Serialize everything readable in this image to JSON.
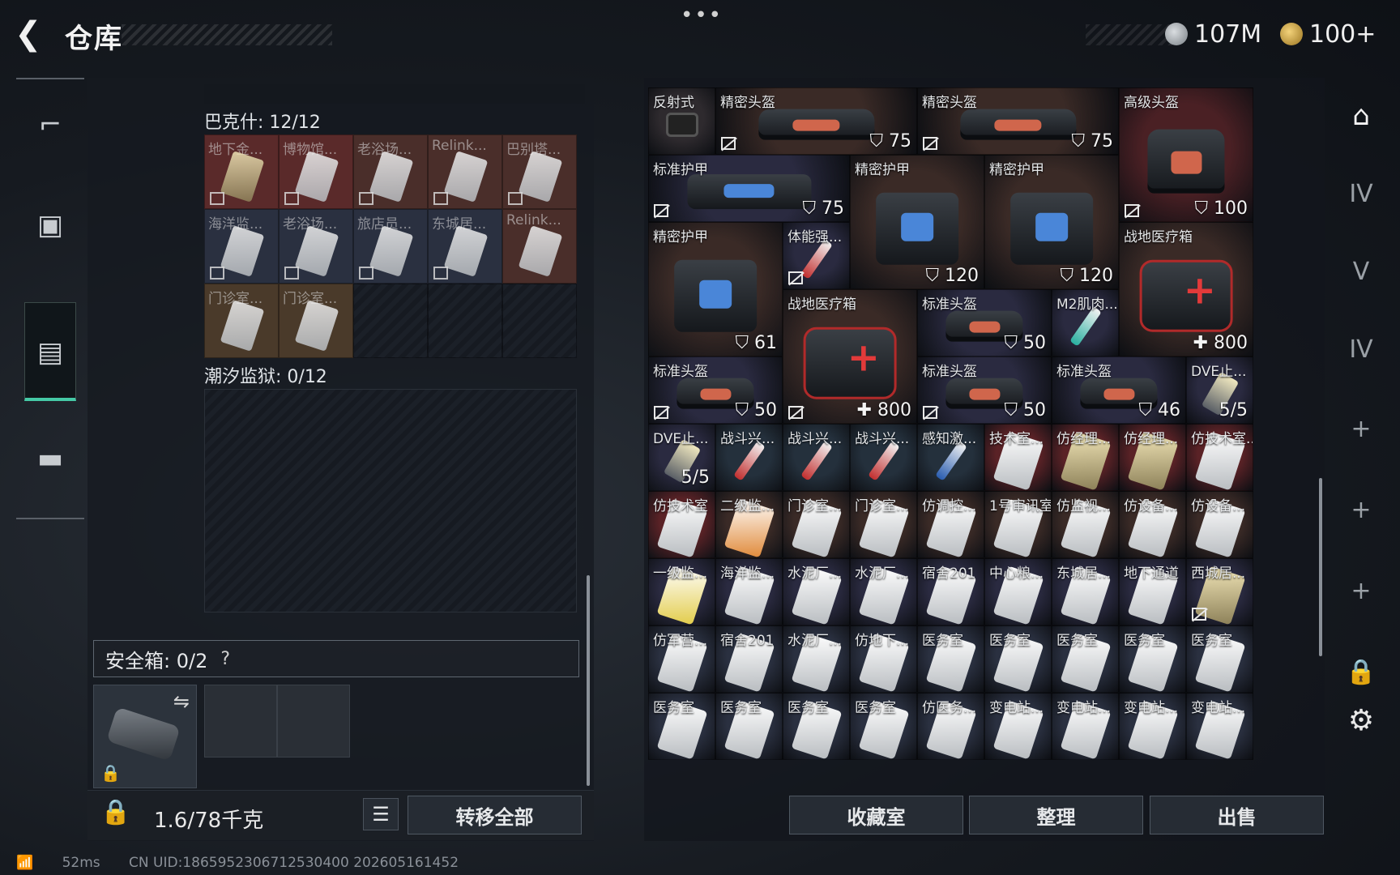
{
  "header": {
    "title": "仓库",
    "back_icon": "chevron-left-icon",
    "more": "•••",
    "currency": [
      {
        "icon": "silver-coin-icon",
        "value": "107M"
      },
      {
        "icon": "gold-coin-icon",
        "value": "100+"
      }
    ]
  },
  "left_rail": {
    "items": [
      "gun-icon",
      "backpack-icon",
      "vest-icon",
      "toolbox-icon"
    ],
    "active_index": 2,
    "active_color": "#45c9a6"
  },
  "containers": {
    "bakesh": {
      "label": "巴克什: 12/12",
      "items": [
        {
          "name": "地下金...",
          "bg": "#5a2a2a",
          "card": "gold",
          "nobind": true
        },
        {
          "name": "博物馆...",
          "bg": "#5a2a2a",
          "card": "white",
          "nobind": true
        },
        {
          "name": "老浴场...",
          "bg": "#4a2e2a",
          "card": "white",
          "nobind": true
        },
        {
          "name": "Relink...",
          "bg": "#4a2e2a",
          "card": "white",
          "nobind": true
        },
        {
          "name": "巴别塔...",
          "bg": "#4a2e2a",
          "card": "white",
          "nobind": true
        },
        {
          "name": "海洋监...",
          "bg": "#2a3040",
          "card": "white",
          "nobind": true
        },
        {
          "name": "老浴场...",
          "bg": "#2a3040",
          "card": "white",
          "nobind": true
        },
        {
          "name": "旅店员...",
          "bg": "#2a3040",
          "card": "white",
          "nobind": true
        },
        {
          "name": "东城居...",
          "bg": "#2a3040",
          "card": "white",
          "nobind": true
        },
        {
          "name": "Relink...",
          "bg": "#4a2e2a",
          "card": "white",
          "nobind": false
        },
        {
          "name": "门诊室...",
          "bg": "#4a3a2a",
          "card": "white",
          "nobind": false
        },
        {
          "name": "门诊室...",
          "bg": "#4a3a2a",
          "card": "white",
          "nobind": false
        }
      ]
    },
    "chaoxi": {
      "label": "潮汐监狱: 0/12"
    },
    "safe": {
      "label": "安全箱: 0/2",
      "help": "?",
      "swap_icon": "swap-icon",
      "lock_icon": "lock-icon"
    }
  },
  "weight": {
    "text": "1.6/78千克",
    "lock_icon": "lock-icon"
  },
  "buttons": {
    "list_icon": "list-icon",
    "transfer_all": "转移全部",
    "collection": "收藏室",
    "sort": "整理",
    "sell": "出售"
  },
  "warehouse": {
    "items": [
      {
        "name": "反射式",
        "c": 0,
        "r": 0,
        "w": 1,
        "h": 1,
        "bg": "#2e2a2e",
        "sprite": "scope"
      },
      {
        "name": "精密头盔",
        "c": 1,
        "r": 0,
        "w": 3,
        "h": 1,
        "bg": "#3a2a26",
        "sprite": "helmet",
        "value": "⛉ 75",
        "nobind": true
      },
      {
        "name": "精密头盔",
        "c": 4,
        "r": 0,
        "w": 3,
        "h": 1,
        "bg": "#3a2a26",
        "sprite": "helmet",
        "value": "⛉ 75",
        "nobind": true
      },
      {
        "name": "高级头盔",
        "c": 7,
        "r": 0,
        "w": 2,
        "h": 2,
        "bg": "#4a2024",
        "sprite": "helmet",
        "value": "⛉ 100",
        "nobind": true
      },
      {
        "name": "标准护甲",
        "c": 0,
        "r": 1,
        "w": 3,
        "h": 1,
        "bg": "#2a2a40",
        "sprite": "armor",
        "value": "⛉ 75",
        "nobind": true
      },
      {
        "name": "精密护甲",
        "c": 3,
        "r": 1,
        "w": 2,
        "h": 2,
        "bg": "#3a2a26",
        "sprite": "armor",
        "value": "⛉ 120"
      },
      {
        "name": "精密护甲",
        "c": 5,
        "r": 1,
        "w": 2,
        "h": 2,
        "bg": "#3a2a26",
        "sprite": "armor",
        "value": "⛉ 120"
      },
      {
        "name": "精密护甲",
        "c": 0,
        "r": 2,
        "w": 2,
        "h": 2,
        "bg": "#3a2a26",
        "sprite": "armor",
        "value": "⛉ 61"
      },
      {
        "name": "体能强...",
        "c": 2,
        "r": 2,
        "w": 1,
        "h": 1,
        "bg": "#2a2a40",
        "sprite": "syringe",
        "nobind": true
      },
      {
        "name": "战地医疗箱",
        "c": 7,
        "r": 2,
        "w": 2,
        "h": 2,
        "bg": "#3a2a26",
        "sprite": "medkit",
        "value": "✚ 800"
      },
      {
        "name": "战地医疗箱",
        "c": 2,
        "r": 3,
        "w": 2,
        "h": 2,
        "bg": "#3a2a26",
        "sprite": "medkit",
        "value": "✚ 800",
        "nobind": true
      },
      {
        "name": "标准头盔",
        "c": 4,
        "r": 3,
        "w": 2,
        "h": 1,
        "bg": "#2a2a40",
        "sprite": "helmet",
        "value": "⛉ 50"
      },
      {
        "name": "M2肌肉...",
        "c": 6,
        "r": 3,
        "w": 1,
        "h": 1,
        "bg": "#2a2a40",
        "sprite": "syringe teal"
      },
      {
        "name": "标准头盔",
        "c": 0,
        "r": 4,
        "w": 2,
        "h": 1,
        "bg": "#2a2a40",
        "sprite": "helmet",
        "value": "⛉ 50",
        "nobind": true
      },
      {
        "name": "标准头盔",
        "c": 4,
        "r": 4,
        "w": 2,
        "h": 1,
        "bg": "#2a2a40",
        "sprite": "helmet",
        "value": "⛉ 50",
        "nobind": true
      },
      {
        "name": "标准头盔",
        "c": 6,
        "r": 4,
        "w": 2,
        "h": 1,
        "bg": "#2a2a40",
        "sprite": "helmet",
        "value": "⛉ 46"
      },
      {
        "name": "DVE止...",
        "c": 8,
        "r": 4,
        "w": 1,
        "h": 1,
        "bg": "#2a2a40",
        "sprite": "dve",
        "value": "5/5"
      },
      {
        "name": "DVE止...",
        "c": 0,
        "r": 5,
        "w": 1,
        "h": 1,
        "bg": "#2a2a40",
        "sprite": "dve",
        "value": "5/5"
      },
      {
        "name": "战斗兴...",
        "c": 1,
        "r": 5,
        "w": 1,
        "h": 1,
        "bg": "#24303c",
        "sprite": "syringe"
      },
      {
        "name": "战斗兴...",
        "c": 2,
        "r": 5,
        "w": 1,
        "h": 1,
        "bg": "#24303c",
        "sprite": "syringe"
      },
      {
        "name": "战斗兴...",
        "c": 3,
        "r": 5,
        "w": 1,
        "h": 1,
        "bg": "#24303c",
        "sprite": "syringe"
      },
      {
        "name": "感知激...",
        "c": 4,
        "r": 5,
        "w": 1,
        "h": 1,
        "bg": "#24303c",
        "sprite": "syringe blue"
      },
      {
        "name": "技术室...",
        "c": 5,
        "r": 5,
        "w": 1,
        "h": 1,
        "bg": "#5a2226",
        "sprite": "card"
      },
      {
        "name": "仿经理...",
        "c": 6,
        "r": 5,
        "w": 1,
        "h": 1,
        "bg": "#5a2226",
        "sprite": "card gold"
      },
      {
        "name": "仿经理...",
        "c": 7,
        "r": 5,
        "w": 1,
        "h": 1,
        "bg": "#5a2226",
        "sprite": "card gold"
      },
      {
        "name": "仿技术室...",
        "c": 8,
        "r": 5,
        "w": 1,
        "h": 1,
        "bg": "#5a2226",
        "sprite": "card"
      },
      {
        "name": "仿技术室",
        "c": 0,
        "r": 6,
        "w": 1,
        "h": 1,
        "bg": "#5a2226",
        "sprite": "card"
      },
      {
        "name": "二级监...",
        "c": 1,
        "r": 6,
        "w": 1,
        "h": 1,
        "bg": "#3a2a26",
        "sprite": "card orange"
      },
      {
        "name": "门诊室...",
        "c": 2,
        "r": 6,
        "w": 1,
        "h": 1,
        "bg": "#3a2a26",
        "sprite": "card"
      },
      {
        "name": "门诊室...",
        "c": 3,
        "r": 6,
        "w": 1,
        "h": 1,
        "bg": "#3a2a26",
        "sprite": "card"
      },
      {
        "name": "仿调控...",
        "c": 4,
        "r": 6,
        "w": 1,
        "h": 1,
        "bg": "#3a2a26",
        "sprite": "card"
      },
      {
        "name": "1号审讯室",
        "c": 5,
        "r": 6,
        "w": 1,
        "h": 1,
        "bg": "#3a2a26",
        "sprite": "card"
      },
      {
        "name": "仿监视...",
        "c": 6,
        "r": 6,
        "w": 1,
        "h": 1,
        "bg": "#3a2a26",
        "sprite": "card"
      },
      {
        "name": "仿设备...",
        "c": 7,
        "r": 6,
        "w": 1,
        "h": 1,
        "bg": "#3a2a26",
        "sprite": "card"
      },
      {
        "name": "仿设备...",
        "c": 8,
        "r": 6,
        "w": 1,
        "h": 1,
        "bg": "#3a2a26",
        "sprite": "card"
      },
      {
        "name": "一级监...",
        "c": 0,
        "r": 7,
        "w": 1,
        "h": 1,
        "bg": "#2a2a40",
        "sprite": "card yellow"
      },
      {
        "name": "海洋监...",
        "c": 1,
        "r": 7,
        "w": 1,
        "h": 1,
        "bg": "#2a2a40",
        "sprite": "card"
      },
      {
        "name": "水泥厂...",
        "c": 2,
        "r": 7,
        "w": 1,
        "h": 1,
        "bg": "#2a2a40",
        "sprite": "card"
      },
      {
        "name": "水泥厂...",
        "c": 3,
        "r": 7,
        "w": 1,
        "h": 1,
        "bg": "#2a2a40",
        "sprite": "card"
      },
      {
        "name": "宿舍201",
        "c": 4,
        "r": 7,
        "w": 1,
        "h": 1,
        "bg": "#2a2a40",
        "sprite": "card"
      },
      {
        "name": "中心粮...",
        "c": 5,
        "r": 7,
        "w": 1,
        "h": 1,
        "bg": "#2a2a40",
        "sprite": "card"
      },
      {
        "name": "东城居...",
        "c": 6,
        "r": 7,
        "w": 1,
        "h": 1,
        "bg": "#2a2a40",
        "sprite": "card"
      },
      {
        "name": "地下通道",
        "c": 7,
        "r": 7,
        "w": 1,
        "h": 1,
        "bg": "#2a2a40",
        "sprite": "card"
      },
      {
        "name": "西城居...",
        "c": 8,
        "r": 7,
        "w": 1,
        "h": 1,
        "bg": "#2a2a40",
        "sprite": "card gold",
        "nobind": true
      },
      {
        "name": "仿军营...",
        "c": 0,
        "r": 8,
        "w": 1,
        "h": 1,
        "bg": "#2a3040",
        "sprite": "card"
      },
      {
        "name": "宿舍201",
        "c": 1,
        "r": 8,
        "w": 1,
        "h": 1,
        "bg": "#2a3040",
        "sprite": "card"
      },
      {
        "name": "水泥厂...",
        "c": 2,
        "r": 8,
        "w": 1,
        "h": 1,
        "bg": "#2a3040",
        "sprite": "card"
      },
      {
        "name": "仿地下...",
        "c": 3,
        "r": 8,
        "w": 1,
        "h": 1,
        "bg": "#2a3040",
        "sprite": "card"
      },
      {
        "name": "医务室",
        "c": 4,
        "r": 8,
        "w": 1,
        "h": 1,
        "bg": "#2a3040",
        "sprite": "card"
      },
      {
        "name": "医务室",
        "c": 5,
        "r": 8,
        "w": 1,
        "h": 1,
        "bg": "#2a3040",
        "sprite": "card"
      },
      {
        "name": "医务室",
        "c": 6,
        "r": 8,
        "w": 1,
        "h": 1,
        "bg": "#2a3040",
        "sprite": "card"
      },
      {
        "name": "医务室",
        "c": 7,
        "r": 8,
        "w": 1,
        "h": 1,
        "bg": "#2a3040",
        "sprite": "card"
      },
      {
        "name": "医务室",
        "c": 8,
        "r": 8,
        "w": 1,
        "h": 1,
        "bg": "#2a3040",
        "sprite": "card"
      },
      {
        "name": "医务室",
        "c": 0,
        "r": 9,
        "w": 1,
        "h": 1,
        "bg": "#2a3040",
        "sprite": "card"
      },
      {
        "name": "医务室",
        "c": 1,
        "r": 9,
        "w": 1,
        "h": 1,
        "bg": "#2a3040",
        "sprite": "card"
      },
      {
        "name": "医务室",
        "c": 2,
        "r": 9,
        "w": 1,
        "h": 1,
        "bg": "#2a3040",
        "sprite": "card"
      },
      {
        "name": "医务室",
        "c": 3,
        "r": 9,
        "w": 1,
        "h": 1,
        "bg": "#2a3040",
        "sprite": "card"
      },
      {
        "name": "仿医务...",
        "c": 4,
        "r": 9,
        "w": 1,
        "h": 1,
        "bg": "#2a3040",
        "sprite": "card"
      },
      {
        "name": "变电站...",
        "c": 5,
        "r": 9,
        "w": 1,
        "h": 1,
        "bg": "#2a3040",
        "sprite": "card"
      },
      {
        "name": "变电站...",
        "c": 6,
        "r": 9,
        "w": 1,
        "h": 1,
        "bg": "#2a3040",
        "sprite": "card"
      },
      {
        "name": "变电站...",
        "c": 7,
        "r": 9,
        "w": 1,
        "h": 1,
        "bg": "#2a3040",
        "sprite": "card"
      },
      {
        "name": "变电站...",
        "c": 8,
        "r": 9,
        "w": 1,
        "h": 1,
        "bg": "#2a3040",
        "sprite": "card"
      }
    ]
  },
  "right_rail": {
    "items": [
      "home-icon",
      "storage-IV-icon",
      "storage-V-icon",
      "storage-IV-folder-icon",
      "plus-icon",
      "plus-icon",
      "plus-icon",
      "lock-icon",
      "settings-icon"
    ],
    "labels": [
      "",
      "IV",
      "V",
      "IV",
      "+",
      "+",
      "+",
      "🔒",
      "⚙"
    ]
  },
  "footer": {
    "ping": "52ms",
    "uid": "CN UID:1865952306712530400 202605161452"
  }
}
